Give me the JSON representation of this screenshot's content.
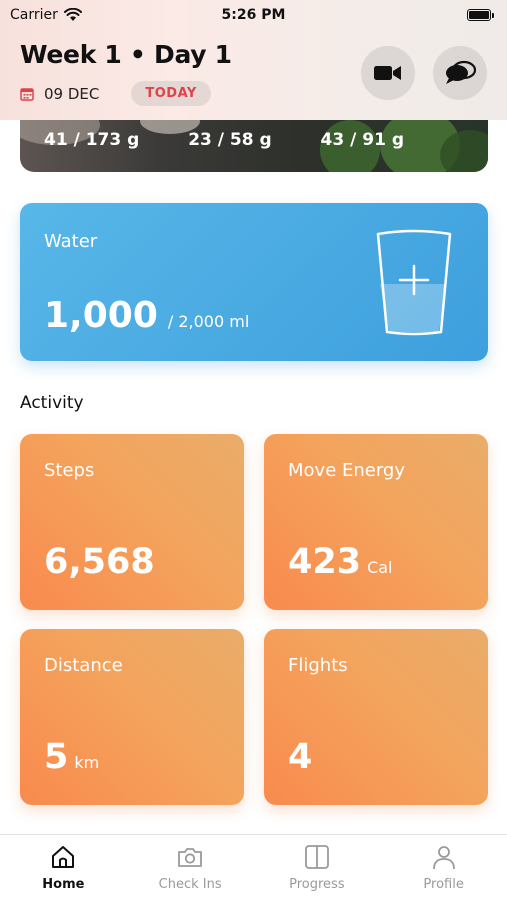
{
  "status_bar": {
    "carrier": "Carrier",
    "time": "5:26 PM"
  },
  "header": {
    "title": "Week 1 • Day 1",
    "date": "09 DEC",
    "today_badge": "TODAY",
    "icons": [
      "calendar-icon",
      "video-camera-icon",
      "chat-bubbles-icon"
    ]
  },
  "macros": {
    "items": [
      "41 / 173 g",
      "23 / 58 g",
      "43 / 91 g"
    ]
  },
  "water": {
    "label": "Water",
    "value": "1,000",
    "goal": "/ 2,000 ml",
    "fill_fraction": 0.5
  },
  "activity": {
    "title": "Activity",
    "cards": [
      {
        "label": "Steps",
        "value": "6,568",
        "unit": ""
      },
      {
        "label": "Move Energy",
        "value": "423",
        "unit": "Cal"
      },
      {
        "label": "Distance",
        "value": "5",
        "unit": "km"
      },
      {
        "label": "Flights",
        "value": "4",
        "unit": ""
      }
    ]
  },
  "tab_bar": {
    "items": [
      {
        "label": "Home",
        "icon": "home-icon",
        "active": true
      },
      {
        "label": "Check Ins",
        "icon": "camera-icon",
        "active": false
      },
      {
        "label": "Progress",
        "icon": "split-panel-icon",
        "active": false
      },
      {
        "label": "Profile",
        "icon": "person-icon",
        "active": false
      }
    ]
  },
  "colors": {
    "water_card": "#4aa9e2",
    "activity_card": "#f4995a",
    "today_text": "#e0424b"
  }
}
